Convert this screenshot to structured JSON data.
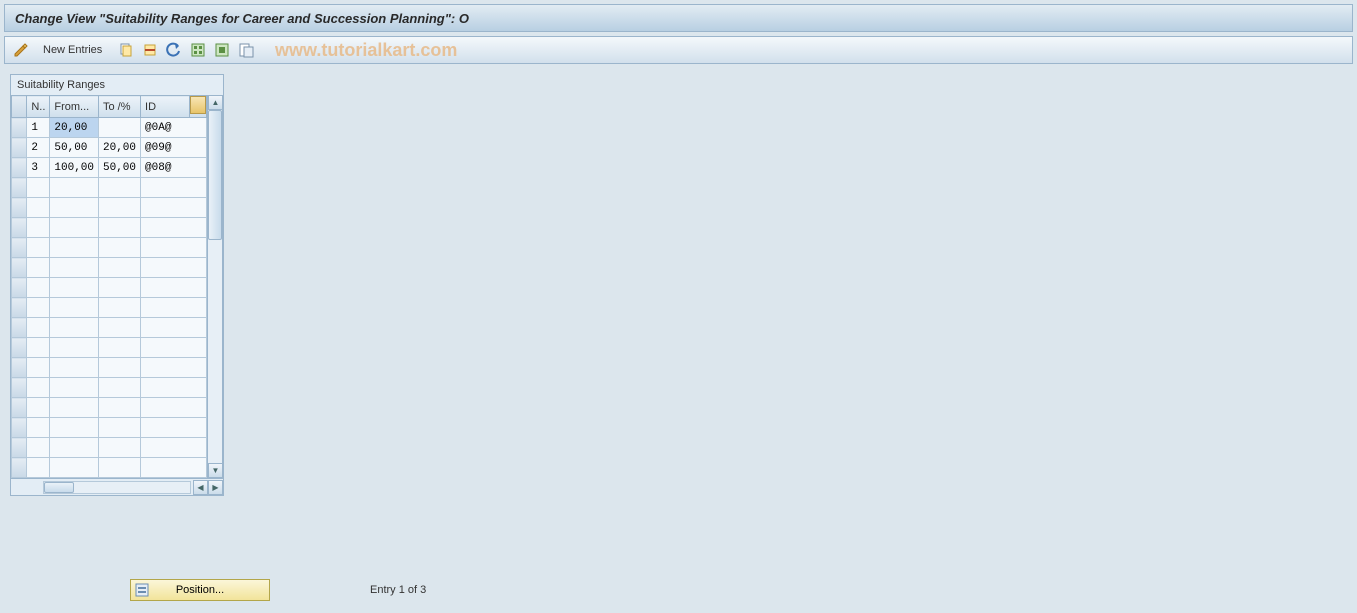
{
  "title": "Change View \"Suitability Ranges for Career and Succession Planning\": O",
  "toolbar": {
    "new_entries_label": "New Entries",
    "pencil_icon": "edit-icon",
    "copy_icon": "copy-icon",
    "delete_icon": "delete-icon",
    "undo_icon": "undo-icon",
    "select_all_icon": "select-all-icon",
    "deselect_icon": "select-block-icon",
    "save_var_icon": "variant-icon"
  },
  "watermark": "www.tutorialkart.com",
  "panel": {
    "title": "Suitability Ranges",
    "columns": {
      "n": "N..",
      "from": "From...",
      "to": "To /%",
      "id": "ID"
    },
    "rows": [
      {
        "n": "1",
        "from": "20,00",
        "to": "",
        "id": "@0A@",
        "selected": true
      },
      {
        "n": "2",
        "from": "50,00",
        "to": "20,00",
        "id": "@09@",
        "selected": false
      },
      {
        "n": "3",
        "from": "100,00",
        "to": "50,00",
        "id": "@08@",
        "selected": false
      }
    ],
    "empty_rows": 15
  },
  "footer": {
    "position_label": "Position...",
    "entry_text": "Entry 1 of 3"
  }
}
